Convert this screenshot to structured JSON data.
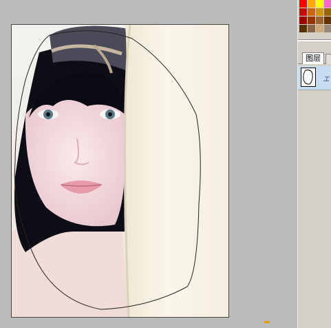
{
  "panel": {
    "layers_tab": "图层",
    "layer_name": "エ",
    "swatch_colors": [
      "#ff0000",
      "#ffaa00",
      "#ffff00",
      "#ff66cc",
      "#cc0000",
      "#cc6600",
      "#cc9900",
      "#996600",
      "#990000",
      "#993300",
      "#996633",
      "#663300",
      "#553300",
      "#886644",
      "#ccaa77",
      "#998877"
    ]
  },
  "colors": {
    "workspace": "#bcbcbc",
    "panel": "#d4d0c8",
    "layer_selected": "#c6dcf0"
  }
}
